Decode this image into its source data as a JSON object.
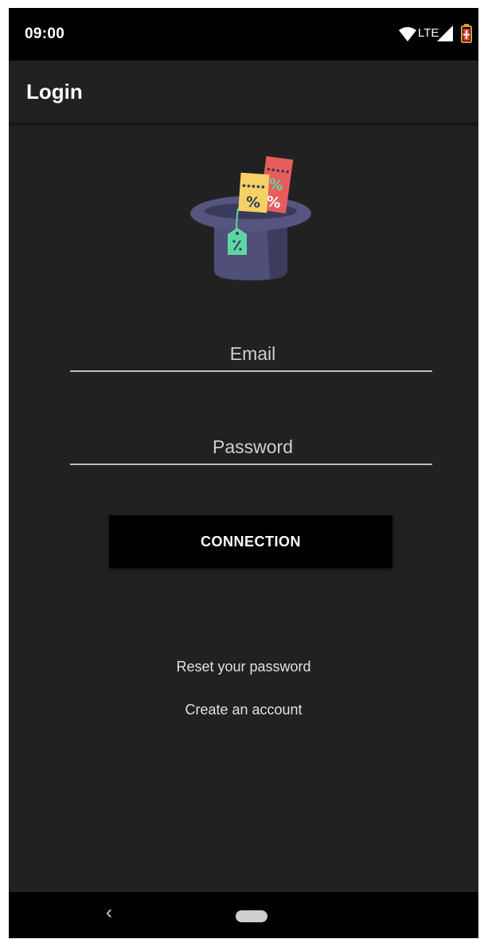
{
  "status_bar": {
    "time": "09:00",
    "network": "LTE",
    "icons": [
      "wifi-icon",
      "signal-icon",
      "battery-charging-icon"
    ]
  },
  "app_bar": {
    "title": "Login"
  },
  "logo": {
    "icon": "magic-hat-discount-icon",
    "tags": [
      "%",
      "%",
      "%"
    ]
  },
  "form": {
    "email_placeholder": "Email",
    "email_value": "",
    "password_placeholder": "Password",
    "password_value": "",
    "connect_label": "CONNECTION"
  },
  "links": {
    "reset_password": "Reset your password",
    "create_account": "Create an account"
  },
  "nav_bar": {
    "back_symbol": "‹",
    "icons": [
      "back-icon",
      "home-pill-icon"
    ]
  },
  "colors": {
    "background": "#212121",
    "status_bar": "#000000",
    "button": "#000000",
    "text": "#ffffff",
    "hat": "#4a4a72",
    "tag_yellow": "#f5d166",
    "tag_red": "#e85c5c",
    "tag_green": "#5ed6a4"
  }
}
